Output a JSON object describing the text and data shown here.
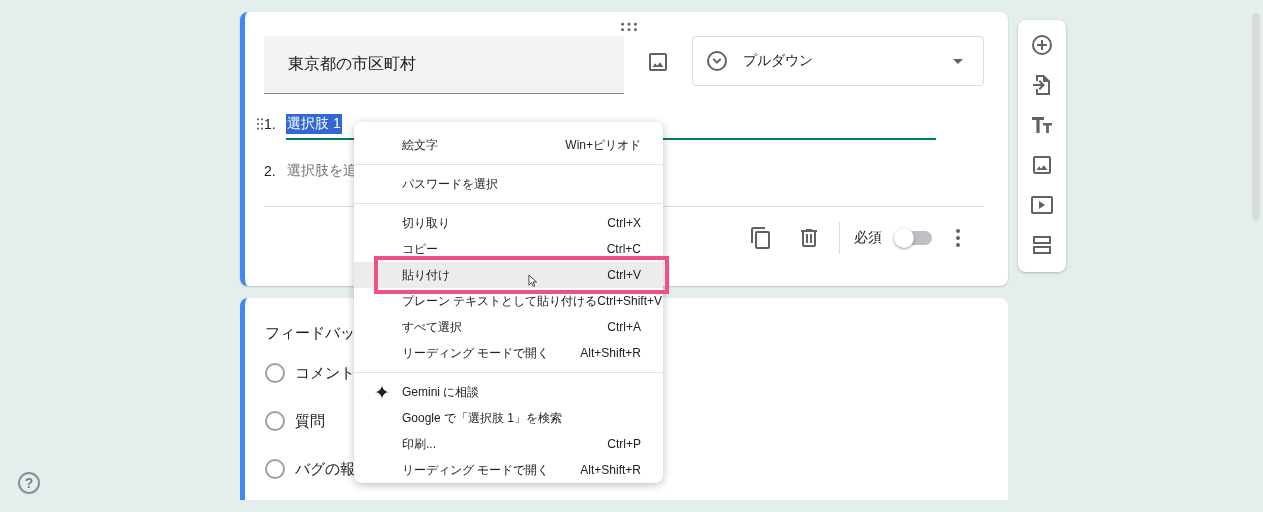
{
  "question_card": {
    "title": "東京都の市区町村",
    "type_dropdown": {
      "label": "プルダウン"
    },
    "options": [
      {
        "number": "1.",
        "text": "選択肢 1",
        "kind": "option",
        "text_selected": true
      },
      {
        "number": "2.",
        "text": "選択肢を追",
        "kind": "add",
        "text_selected": false
      }
    ],
    "required": {
      "label": "必須",
      "on": false
    }
  },
  "second_card": {
    "title": "フィードバッ",
    "options": [
      {
        "label": "コメント",
        "selected": false
      },
      {
        "label": "質問",
        "selected": false
      },
      {
        "label": "バグの報",
        "selected": false
      }
    ]
  },
  "context_menu": {
    "sections": [
      [
        {
          "label": "絵文字",
          "shortcut": "Win+ピリオド",
          "kind": "plain",
          "selected": false,
          "annotated": false
        }
      ],
      [
        {
          "label": "パスワードを選択",
          "kind": "plain",
          "selected": false,
          "annotated": false
        }
      ],
      [
        {
          "label": "切り取り",
          "shortcut": "Ctrl+X",
          "kind": "plain",
          "selected": false,
          "annotated": false
        },
        {
          "label": "コピー",
          "shortcut": "Ctrl+C",
          "kind": "plain",
          "selected": false,
          "annotated": false
        },
        {
          "label": "貼り付け",
          "shortcut": "Ctrl+V",
          "kind": "plain",
          "selected": true,
          "annotated": true
        },
        {
          "label": "プレーン テキストとして貼り付ける",
          "shortcut": "Ctrl+Shift+V",
          "kind": "plain",
          "selected": false,
          "annotated": false
        },
        {
          "label": "すべて選択",
          "shortcut": "Ctrl+A",
          "kind": "plain",
          "selected": false,
          "annotated": false
        },
        {
          "label": "リーディング モードで開く",
          "shortcut": "Alt+Shift+R",
          "kind": "plain",
          "selected": false,
          "annotated": false
        }
      ],
      [
        {
          "label": "Gemini に相談",
          "kind": "assistant",
          "selected": false,
          "annotated": false
        },
        {
          "label": "Google で「選択肢 1」を検索",
          "kind": "plain",
          "selected": false,
          "annotated": false
        },
        {
          "label": "印刷...",
          "shortcut": "Ctrl+P",
          "kind": "plain",
          "selected": false,
          "annotated": false
        },
        {
          "label": "リーディング モードで開く",
          "shortcut": "Alt+Shift+R",
          "kind": "plain",
          "selected": false,
          "annotated": false
        }
      ]
    ]
  },
  "help": {
    "label": "?"
  }
}
